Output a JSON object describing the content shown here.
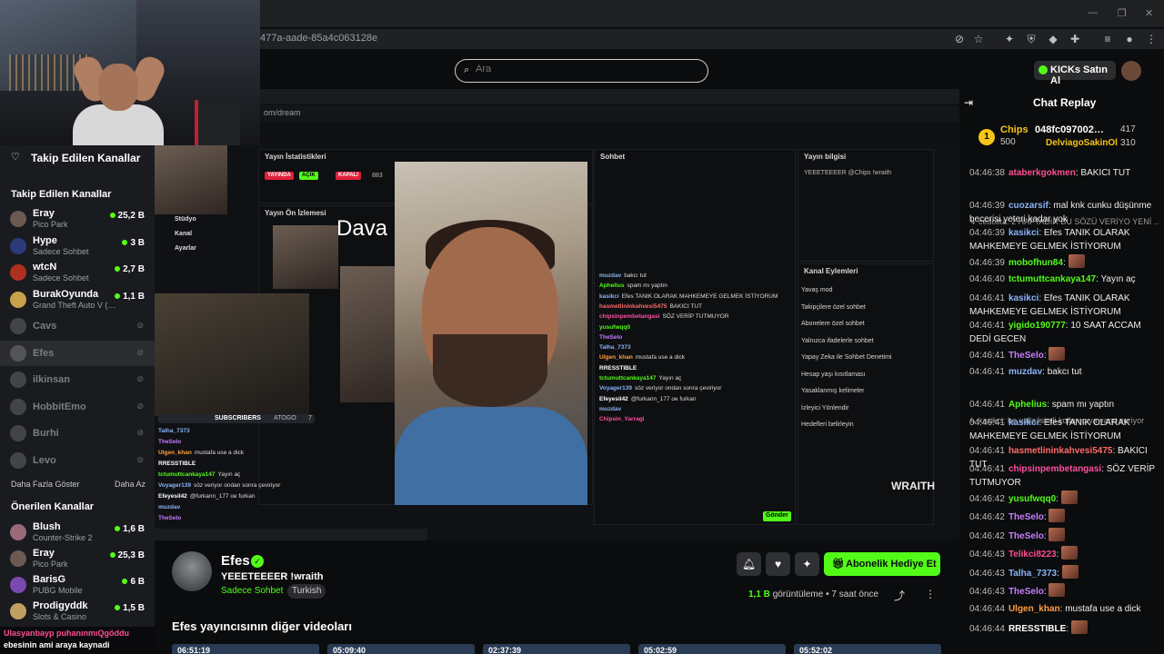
{
  "browser": {
    "url": "477a-aade-85a4c063128e"
  },
  "header": {
    "search_placeholder": "Ara",
    "kicks_label": "KICKs Satın Al"
  },
  "sidebar": {
    "followed_title": "Takip Edilen Kanallar",
    "followed_subtitle": "Takip Edilen Kanallar",
    "followed": [
      {
        "name": "Eray",
        "game": "Pico Park",
        "viewers": "25,2 B",
        "live": true,
        "color": "#6a5a52"
      },
      {
        "name": "Hype",
        "game": "Sadece Sohbet",
        "viewers": "3 B",
        "live": true,
        "color": "#2b3a78"
      },
      {
        "name": "wtcN",
        "game": "Sadece Sohbet",
        "viewers": "2,7 B",
        "live": true,
        "color": "#b03020"
      },
      {
        "name": "BurakOyunda",
        "game": "Grand Theft Auto V (…",
        "viewers": "1,1 B",
        "live": true,
        "color": "#c9a14a"
      },
      {
        "name": "Cavs",
        "live": false,
        "color": "#777"
      },
      {
        "name": "Efes",
        "live": false,
        "color": "#888"
      },
      {
        "name": "ilkinsan",
        "live": false,
        "color": "#777"
      },
      {
        "name": "HobbitEmo",
        "live": false,
        "color": "#777"
      },
      {
        "name": "Burhi",
        "live": false,
        "color": "#777"
      },
      {
        "name": "Levo",
        "live": false,
        "color": "#777"
      }
    ],
    "show_more": "Daha Fazla Göster",
    "show_less": "Daha Az",
    "recommended_title": "Önerilen Kanallar",
    "recommended": [
      {
        "name": "Blush",
        "game": "Counter-Strike 2",
        "viewers": "1,6 B",
        "color": "#9a6a78"
      },
      {
        "name": "Eray",
        "game": "Pico Park",
        "viewers": "25,3 B",
        "color": "#6a5a52"
      },
      {
        "name": "BarisG",
        "game": "PUBG Mobile",
        "viewers": "6 B",
        "color": "#7a4ab0"
      },
      {
        "name": "Prodigyddk",
        "game": "Slots & Casino",
        "viewers": "1,5 B",
        "color": "#c0a060"
      }
    ]
  },
  "ticker": {
    "line1": "Ulasyanbayp puhanınmıQgöddu",
    "line2": "ebesinin ami araya kaynadi"
  },
  "video_overlay": {
    "url": "om/dream",
    "stats_title": "Yayın İstatistikleri",
    "preview_title": "Yayın Ön İzlemesi",
    "chat_title": "Sohbet",
    "info_title": "Yayın bilgisi",
    "info_text": "YEEETEEEER @Chips !wraith",
    "actions_title": "Kanal Eylemleri",
    "banner_text": "Dava",
    "wraith": "WRAITH",
    "send_label": "Gönder",
    "menu": [
      "Stüdyo",
      "Kanal",
      "Ayarlar"
    ],
    "stat_tags": [
      "YAYINDA",
      "AÇIK",
      "KAPALI"
    ],
    "stat_num": "883",
    "actions": [
      "Yavaş mod",
      "Takipçilere özel sohbet",
      "Abonelere özel sohbet",
      "Yalnızca ifadelerle sohbet",
      "Yapay Zeka ile Sohbet Denetimi",
      "Hesap yaşı kısıtlaması",
      "Yasaklanmış kelimeler",
      "İzleyici Yönlendir",
      "Hedefleri belirleyin"
    ],
    "chat_lines": [
      {
        "u": "muzdav",
        "t": "bakcı tut",
        "c": "#8ab4f8"
      },
      {
        "u": "Aphelius",
        "t": "spam mı yaptın",
        "c": "#53fc18"
      },
      {
        "u": "kasikci",
        "t": "Efes TANIK OLARAK MAHKEMEYE GELMEK İSTİYORUM",
        "c": "#8ab4f8"
      },
      {
        "u": "hasmetlininkahvesi5475",
        "t": "BAKICI TUT",
        "c": "#ff6b6b"
      },
      {
        "u": "chipsinpembetangasi",
        "t": "SÖZ VERİP TUTMUYOR",
        "c": "#ff4fa3"
      },
      {
        "u": "yusufwqq0",
        "t": "",
        "c": "#53fc18"
      },
      {
        "u": "TheSelo",
        "t": "",
        "c": "#c77dff"
      },
      {
        "u": "Talha_7373",
        "t": "",
        "c": "#8ab4f8"
      },
      {
        "u": "Ulgen_khan",
        "t": "mustafa use a dick",
        "c": "#ff9f43"
      },
      {
        "u": "RRESSTIBLE",
        "t": "",
        "c": "#fff"
      },
      {
        "u": "tctumuttcankaya147",
        "t": "Yayın aç",
        "c": "#53fc18"
      },
      {
        "u": "Voyager139",
        "t": "söz veriyor ondan sonra çeviriyor",
        "c": "#8ab4f8"
      },
      {
        "u": "Efeyesil42",
        "t": "@furkann_177 oe furkan",
        "c": "#fff"
      },
      {
        "u": "muzdav",
        "t": "",
        "c": "#8ab4f8"
      },
      {
        "u": "Chipsin_Yarragi",
        "t": "",
        "c": "#ff4fa3"
      }
    ],
    "left_chat": [
      {
        "u": "Talha_7373",
        "t": "",
        "c": "#8ab4f8"
      },
      {
        "u": "TheSelo",
        "t": "",
        "c": "#c77dff"
      },
      {
        "u": "Ulgen_khan",
        "t": "mustafa use a dick",
        "c": "#ff9f43"
      },
      {
        "u": "RRESSTIBLE",
        "t": "",
        "c": "#fff"
      },
      {
        "u": "tctumuttcankaya147",
        "t": "Yayın aç",
        "c": "#53fc18"
      },
      {
        "u": "Voyager139",
        "t": "söz veriyor ondan sonra çeviriyor",
        "c": "#8ab4f8"
      },
      {
        "u": "Efeyesil42",
        "t": "@furkann_177 oe furkan",
        "c": "#fff"
      },
      {
        "u": "muzdav",
        "t": "",
        "c": "#8ab4f8"
      },
      {
        "u": "TheSelo",
        "t": "",
        "c": "#c77dff"
      }
    ],
    "subs_label": "SUBSCRIBERS",
    "subs_user": "ATOGO",
    "subs_count": "7"
  },
  "channel": {
    "name": "Efes",
    "title": "YEEETEEEER  !wraith",
    "category": "Sadece Sohbet",
    "language": "Turkish",
    "gift_label": "Abonelik Hediye Et",
    "views_count": "1,1 B",
    "views_label": "görüntüleme",
    "time_ago": "7 saat önce",
    "other_videos": "Efes yayıncısının diğer videoları",
    "thumb_durations": [
      "06:51:19",
      "05:09:40",
      "02:37:39",
      "05:02:59",
      "05:52:02"
    ]
  },
  "chat": {
    "title": "Chat Replay",
    "pinned": [
      {
        "name": "Chips",
        "amount": "500",
        "rank": "1"
      },
      {
        "name": "048fc097002…",
        "amount": "417"
      },
      {
        "name": "DelviagoSakinOl",
        "amount": "310"
      }
    ],
    "messages": [
      {
        "ts": "04:46:38",
        "user": "ataberkgokmen",
        "color": "#ff4f8f",
        "text": "BAKICI TUT",
        "emote": false
      },
      {
        "reply": "cedolita: 2 HAFTADIR BU SÖZÜ VERİYO YENİ …"
      },
      {
        "ts": "04:46:39",
        "user": "cuozarsif",
        "color": "#8ab4f8",
        "text": "mal knk cunku düşünme becerisi yeteri kadar yok",
        "emote": false
      },
      {
        "ts": "04:46:39",
        "user": "kasikci",
        "color": "#8ab4f8",
        "text": "Efes TANIK OLARAK MAHKEMEYE GELMEK İSTİYORUM",
        "emote": false
      },
      {
        "ts": "04:46:39",
        "user": "mobofhun84",
        "color": "#53fc18",
        "text": "",
        "emote": true
      },
      {
        "ts": "04:46:40",
        "user": "tctumuttcankaya147",
        "color": "#53fc18",
        "text": "Yayın aç",
        "emote": false
      },
      {
        "ts": "04:46:41",
        "user": "kasikci",
        "color": "#8ab4f8",
        "text": "Efes TANIK OLARAK MAHKEMEYE GELMEK İSTİYORUM",
        "emote": false
      },
      {
        "ts": "04:46:41",
        "user": "yigido190777",
        "color": "#53fc18",
        "text": "10 SAAT ACCAM DEDİ GECEN",
        "emote": false
      },
      {
        "ts": "04:46:41",
        "user": "TheSelo",
        "color": "#c77dff",
        "text": "",
        "emote": true
      },
      {
        "ts": "04:46:41",
        "user": "muzdav",
        "color": "#8ab4f8",
        "text": "bakcı tut",
        "emote": false
      },
      {
        "reply": "kasikci: he valla isimli kullanıcıya yanıt veriyor"
      },
      {
        "ts": "04:46:41",
        "user": "Aphelius",
        "color": "#53fc18",
        "text": "spam mı yaptın",
        "emote": false
      },
      {
        "ts": "04:46:41",
        "user": "kasikci",
        "color": "#8ab4f8",
        "text": "Efes TANIK OLARAK MAHKEMEYE GELMEK İSTİYORUM",
        "emote": false
      },
      {
        "ts": "04:46:41",
        "user": "hasmetlininkahvesi5475",
        "color": "#ff6b6b",
        "text": "BAKICI TUT",
        "emote": false
      },
      {
        "ts": "04:46:41",
        "user": "chipsinpembetangasi",
        "color": "#ff4fa3",
        "text": "SÖZ VERİP TUTMUYOR",
        "emote": false
      },
      {
        "ts": "04:46:42",
        "user": "yusufwqq0",
        "color": "#53fc18",
        "text": "",
        "emote": true
      },
      {
        "ts": "04:46:42",
        "user": "TheSelo",
        "color": "#c77dff",
        "text": "",
        "emote": true
      },
      {
        "ts": "04:46:42",
        "user": "TheSelo",
        "color": "#c77dff",
        "text": "",
        "emote": true
      },
      {
        "ts": "04:46:43",
        "user": "Telikci8223",
        "color": "#ff4f8f",
        "text": "",
        "emote": true
      },
      {
        "ts": "04:46:43",
        "user": "Talha_7373",
        "color": "#8ab4f8",
        "text": "",
        "emote": true
      },
      {
        "ts": "04:46:43",
        "user": "TheSelo",
        "color": "#c77dff",
        "text": "",
        "emote": true
      },
      {
        "ts": "04:46:44",
        "user": "Ulgen_khan",
        "color": "#ff9f43",
        "text": "mustafa use a dick",
        "emote": false
      },
      {
        "ts": "04:46:44",
        "user": "RRESSTIBLE",
        "color": "#ffffff",
        "text": "",
        "emote": true
      }
    ]
  },
  "colors": {
    "accent": "#53fc18",
    "background": "#0b0c0d",
    "sidebar": "#191b1f"
  }
}
